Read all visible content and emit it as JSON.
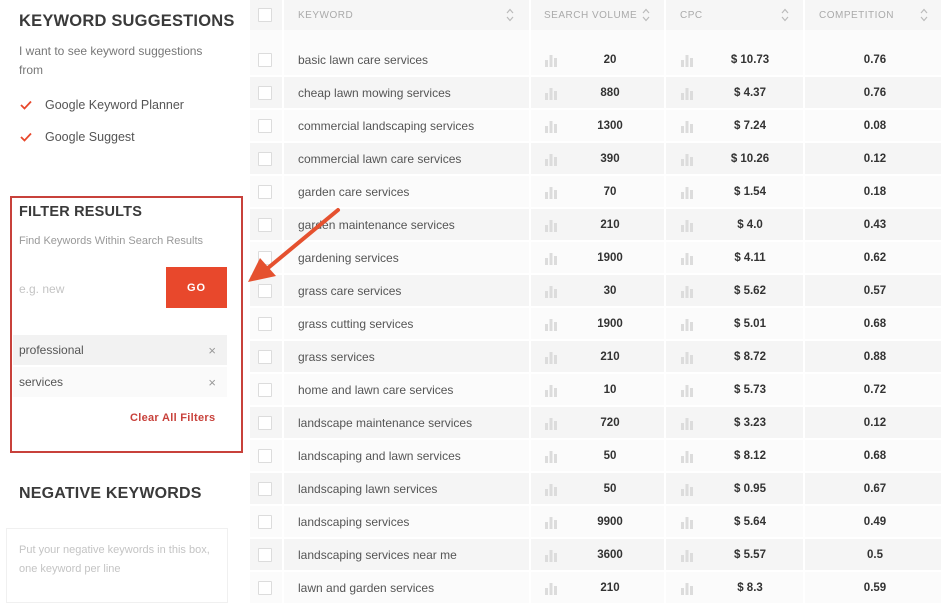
{
  "sidebar": {
    "keyword_suggestions": {
      "title": "KEYWORD SUGGESTIONS",
      "description": "I want to see keyword suggestions from",
      "options": [
        {
          "label": "Google Keyword Planner",
          "checked": true
        },
        {
          "label": "Google Suggest",
          "checked": true
        }
      ]
    },
    "filter_results": {
      "title": "FILTER RESULTS",
      "description": "Find Keywords Within Search Results",
      "input_placeholder": "e.g. new",
      "go_label": "GO",
      "filters": [
        "professional",
        "services"
      ],
      "clear_all_label": "Clear All Filters",
      "remove_symbol": "×"
    },
    "negative_keywords": {
      "title": "NEGATIVE KEYWORDS",
      "placeholder": "Put your negative keywords in this box, one keyword per line"
    }
  },
  "table": {
    "columns": {
      "keyword": "KEYWORD",
      "search_volume": "SEARCH VOLUME",
      "cpc": "CPC",
      "competition": "COMPETITION"
    },
    "rows": [
      {
        "keyword": "basic lawn care services",
        "volume": "20",
        "cpc": "$ 10.73",
        "competition": "0.76"
      },
      {
        "keyword": "cheap lawn mowing services",
        "volume": "880",
        "cpc": "$ 4.37",
        "competition": "0.76"
      },
      {
        "keyword": "commercial landscaping services",
        "volume": "1300",
        "cpc": "$ 7.24",
        "competition": "0.08"
      },
      {
        "keyword": "commercial lawn care services",
        "volume": "390",
        "cpc": "$ 10.26",
        "competition": "0.12"
      },
      {
        "keyword": "garden care services",
        "volume": "70",
        "cpc": "$ 1.54",
        "competition": "0.18"
      },
      {
        "keyword": "garden maintenance services",
        "volume": "210",
        "cpc": "$ 4.0",
        "competition": "0.43"
      },
      {
        "keyword": "gardening services",
        "volume": "1900",
        "cpc": "$ 4.11",
        "competition": "0.62"
      },
      {
        "keyword": "grass care services",
        "volume": "30",
        "cpc": "$ 5.62",
        "competition": "0.57"
      },
      {
        "keyword": "grass cutting services",
        "volume": "1900",
        "cpc": "$ 5.01",
        "competition": "0.68"
      },
      {
        "keyword": "grass services",
        "volume": "210",
        "cpc": "$ 8.72",
        "competition": "0.88"
      },
      {
        "keyword": "home and lawn care services",
        "volume": "10",
        "cpc": "$ 5.73",
        "competition": "0.72"
      },
      {
        "keyword": "landscape maintenance services",
        "volume": "720",
        "cpc": "$ 3.23",
        "competition": "0.12"
      },
      {
        "keyword": "landscaping and lawn services",
        "volume": "50",
        "cpc": "$ 8.12",
        "competition": "0.68"
      },
      {
        "keyword": "landscaping lawn services",
        "volume": "50",
        "cpc": "$ 0.95",
        "competition": "0.67"
      },
      {
        "keyword": "landscaping services",
        "volume": "9900",
        "cpc": "$ 5.64",
        "competition": "0.49"
      },
      {
        "keyword": "landscaping services near me",
        "volume": "3600",
        "cpc": "$ 5.57",
        "competition": "0.5"
      },
      {
        "keyword": "lawn and garden services",
        "volume": "210",
        "cpc": "$ 8.3",
        "competition": "0.59"
      }
    ]
  },
  "colors": {
    "accent": "#e8482c",
    "highlight_border": "#c8413b",
    "annotation_arrow": "#e5512f"
  }
}
